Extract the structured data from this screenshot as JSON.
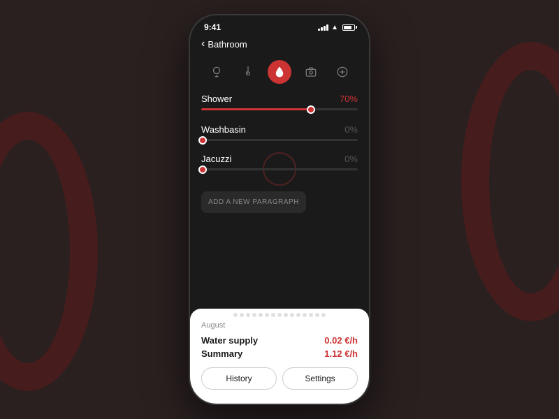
{
  "background": {
    "color": "#2a2020"
  },
  "status_bar": {
    "time": "9:41"
  },
  "header": {
    "back_label": "Bathroom"
  },
  "icon_tabs": [
    {
      "name": "bulb-icon",
      "label": "Bulb",
      "active": false
    },
    {
      "name": "temperature-icon",
      "label": "Temperature",
      "active": false
    },
    {
      "name": "water-icon",
      "label": "Water",
      "active": true
    },
    {
      "name": "camera-icon",
      "label": "Camera",
      "active": false
    },
    {
      "name": "add-icon",
      "label": "Add",
      "active": false
    }
  ],
  "sliders": [
    {
      "label": "Shower",
      "value": "70%",
      "fill_percent": 70,
      "active": true
    },
    {
      "label": "Washbasin",
      "value": "0%",
      "fill_percent": 0,
      "active": false
    },
    {
      "label": "Jacuzzi",
      "value": "0%",
      "fill_percent": 0,
      "active": false
    }
  ],
  "add_paragraph": {
    "label": "ADD A NEW PARAGRAPH"
  },
  "bottom_card": {
    "month": "August",
    "rows": [
      {
        "label": "Water supply",
        "value": "0.02 €/h"
      },
      {
        "label": "Summary",
        "value": "1.12 €/h"
      }
    ],
    "buttons": [
      {
        "label": "History"
      },
      {
        "label": "Settings"
      }
    ]
  }
}
